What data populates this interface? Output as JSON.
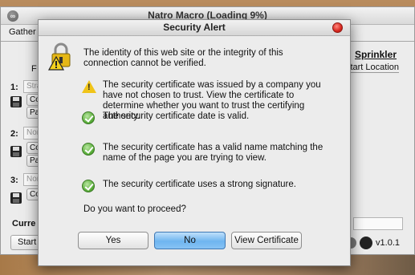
{
  "background_app": {
    "title": "Natro Macro (Loading 9%)",
    "tab_label": "Gather",
    "row_numbers": [
      "1:",
      "2:",
      "3:"
    ],
    "field_placeholders": [
      "Stra",
      "Non",
      "Non"
    ],
    "small_button_a": "Co",
    "small_button_b": "Pa",
    "left_col_letter": "F",
    "sprinkler_label": "Sprinkler",
    "start_location_label": "Start Location",
    "current_label": "Curre",
    "start_button": "Start",
    "version": "v1.0.1"
  },
  "dialog": {
    "title": "Security Alert",
    "intro": "The identity of this web site or the integrity of this connection cannot be verified.",
    "items": [
      {
        "icon": "warning-icon",
        "text": "The security certificate was issued by a company you have not chosen to trust. View the certificate to determine whether you want to trust the certifying authority."
      },
      {
        "icon": "check-icon",
        "text": "The security certificate date is valid."
      },
      {
        "icon": "check-icon",
        "text": "The security certificate has a valid name matching the name of the page you are trying to view."
      },
      {
        "icon": "check-icon",
        "text": "The security certificate uses a strong signature."
      }
    ],
    "question": "Do you want to proceed?",
    "buttons": {
      "yes": "Yes",
      "no": "No",
      "view": "View Certificate"
    }
  },
  "colors": {
    "primary_button": "#6fb5f0",
    "close_button": "#d7261e",
    "warning": "#f0c419",
    "ok": "#58ad38"
  }
}
